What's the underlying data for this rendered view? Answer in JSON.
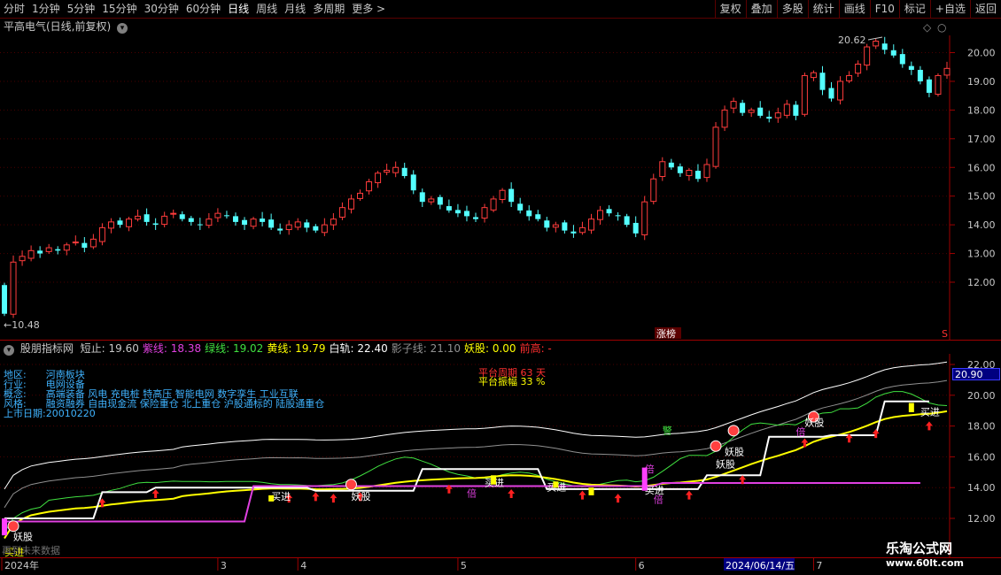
{
  "toolbar": {
    "periods": [
      "分时",
      "1分钟",
      "5分钟",
      "15分钟",
      "30分钟",
      "60分钟",
      "日线",
      "周线",
      "月线",
      "多周期",
      "更多 >"
    ],
    "active_period": "日线",
    "right_buttons": [
      "复权",
      "叠加",
      "多股",
      "统计",
      "画线",
      "F10",
      "标记",
      "+自选",
      "返回"
    ]
  },
  "panel1": {
    "title": "平高电气(日线,前复权)",
    "high_label": "20.62",
    "low_label": "←10.48",
    "zt_label": "涨榜",
    "yaxis_ticks": [
      "20.00",
      "19.00",
      "18.00",
      "17.00",
      "16.00",
      "15.00",
      "14.00",
      "13.00",
      "12.00"
    ]
  },
  "panel2": {
    "name": "股朋指标网",
    "fields": [
      {
        "label": "短止:",
        "value": "19.60",
        "color": "#c8c8c8"
      },
      {
        "label": "紫线:",
        "value": "18.38",
        "color": "#e040e0"
      },
      {
        "label": "绿线:",
        "value": "19.02",
        "color": "#40e040"
      },
      {
        "label": "黄线:",
        "value": "19.79",
        "color": "#ffff00"
      },
      {
        "label": "白轨:",
        "value": "22.40",
        "color": "#ffffff"
      },
      {
        "label": "影子线:",
        "value": "21.10",
        "color": "#909090"
      },
      {
        "label": "妖股:",
        "value": "0.00",
        "color": "#ffff00"
      },
      {
        "label": "前高:",
        "value": "-",
        "color": "#ff3030"
      }
    ],
    "info": [
      {
        "key": "地区:",
        "val": "河南板块"
      },
      {
        "key": "行业:",
        "val": "电网设备"
      },
      {
        "key": "概念:",
        "val": "高端装备 风电 充电桩 特高压 智能电网 数字孪生 工业互联"
      },
      {
        "key": "风格:",
        "val": "融资融券 自由现金流 保险重仓 北上重仓 沪股通标的 陆股通重仓"
      },
      {
        "key": "上市日期:",
        "val": "20010220"
      }
    ],
    "platform_period": "平台周期 63 天",
    "platform_amp": "平台振幅 33 %",
    "current_value": "20.90",
    "yaxis_ticks": [
      "22.00",
      "20.00",
      "18.00",
      "16.00",
      "14.00",
      "12.00"
    ],
    "signals": {
      "buy": "买进",
      "yao": "妖股",
      "bei": "倍",
      "jing": "警"
    },
    "future_label": "再到未来数据"
  },
  "date_axis": {
    "labels": [
      "2024年",
      "3",
      "4",
      "5",
      "6",
      "7"
    ],
    "highlight": "2024/06/14/五"
  },
  "watermark": {
    "line1": "乐淘公式网",
    "line2": "www.60lt.com"
  },
  "chart_data": {
    "type": "candlestick",
    "title": "平高电气(日线,前复权)",
    "ylim": [
      11.0,
      20.9
    ],
    "x_labels": [
      "2024年",
      "3",
      "4",
      "5",
      "6",
      "2024/06/14/五",
      "7"
    ],
    "high": 20.62,
    "low": 10.48,
    "closes": [
      10.9,
      12.7,
      12.9,
      13.1,
      13.0,
      13.2,
      13.1,
      13.3,
      13.4,
      13.2,
      13.5,
      13.9,
      14.1,
      14.0,
      14.2,
      14.3,
      14.1,
      14.0,
      14.3,
      14.4,
      14.2,
      14.1,
      14.0,
      14.2,
      14.4,
      14.3,
      14.1,
      14.0,
      14.2,
      14.1,
      13.9,
      13.8,
      14.0,
      14.1,
      13.9,
      13.8,
      14.0,
      14.2,
      14.6,
      14.9,
      15.1,
      15.5,
      15.8,
      15.9,
      16.0,
      15.7,
      15.2,
      14.8,
      14.9,
      14.7,
      14.5,
      14.4,
      14.3,
      14.2,
      14.6,
      14.9,
      15.2,
      14.8,
      14.5,
      14.3,
      14.2,
      13.9,
      14.0,
      13.8,
      13.7,
      13.9,
      14.2,
      14.5,
      14.4,
      14.3,
      14.0,
      13.7,
      14.8,
      15.6,
      16.2,
      16.0,
      15.8,
      15.9,
      15.6,
      16.1,
      17.4,
      18.0,
      18.3,
      17.9,
      18.0,
      17.8,
      17.7,
      17.9,
      18.2,
      17.8,
      19.2,
      19.3,
      18.7,
      18.4,
      19.0,
      19.2,
      19.6,
      20.2,
      20.4,
      20.1,
      19.9,
      19.6,
      19.4,
      19.0,
      18.6,
      19.2,
      19.45
    ]
  }
}
